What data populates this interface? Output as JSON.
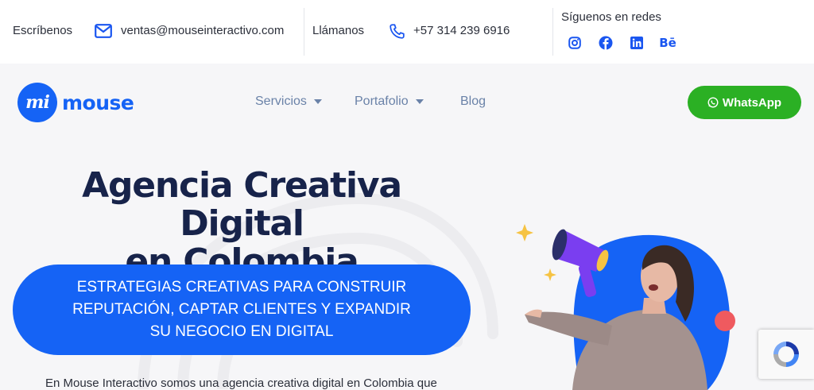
{
  "topbar": {
    "write_label": "Escríbenos",
    "email": "ventas@mouseinteractivo.com",
    "call_label": "Llámanos",
    "phone": "+57 314 239 6916",
    "social_label": "Síguenos en redes",
    "social_icons": [
      "instagram-icon",
      "facebook-icon",
      "linkedin-icon",
      "behance-icon"
    ],
    "behance_glyph": "Bē"
  },
  "logo": {
    "mark": "mi",
    "text": "mouse"
  },
  "nav": {
    "items": [
      {
        "label": "Servicios",
        "has_dropdown": true
      },
      {
        "label": "Portafolio",
        "has_dropdown": true
      },
      {
        "label": "Blog",
        "has_dropdown": false
      }
    ]
  },
  "whatsapp": {
    "label": "WhatsApp",
    "color": "#2bb024"
  },
  "hero": {
    "title_line1": "Agencia Creativa Digital",
    "title_line2": "en Colombia",
    "pill_text": "ESTRATEGIAS CREATIVAS PARA CONSTRUIR REPUTACIÓN, CAPTAR CLIENTES Y EXPANDIR SU NEGOCIO EN DIGITAL",
    "intro": "En Mouse Interactivo somos una agencia creativa digital en Colombia que"
  },
  "colors": {
    "brand_blue": "#1563f5",
    "title_navy": "#17234a",
    "nav_text": "#6a82a8"
  }
}
